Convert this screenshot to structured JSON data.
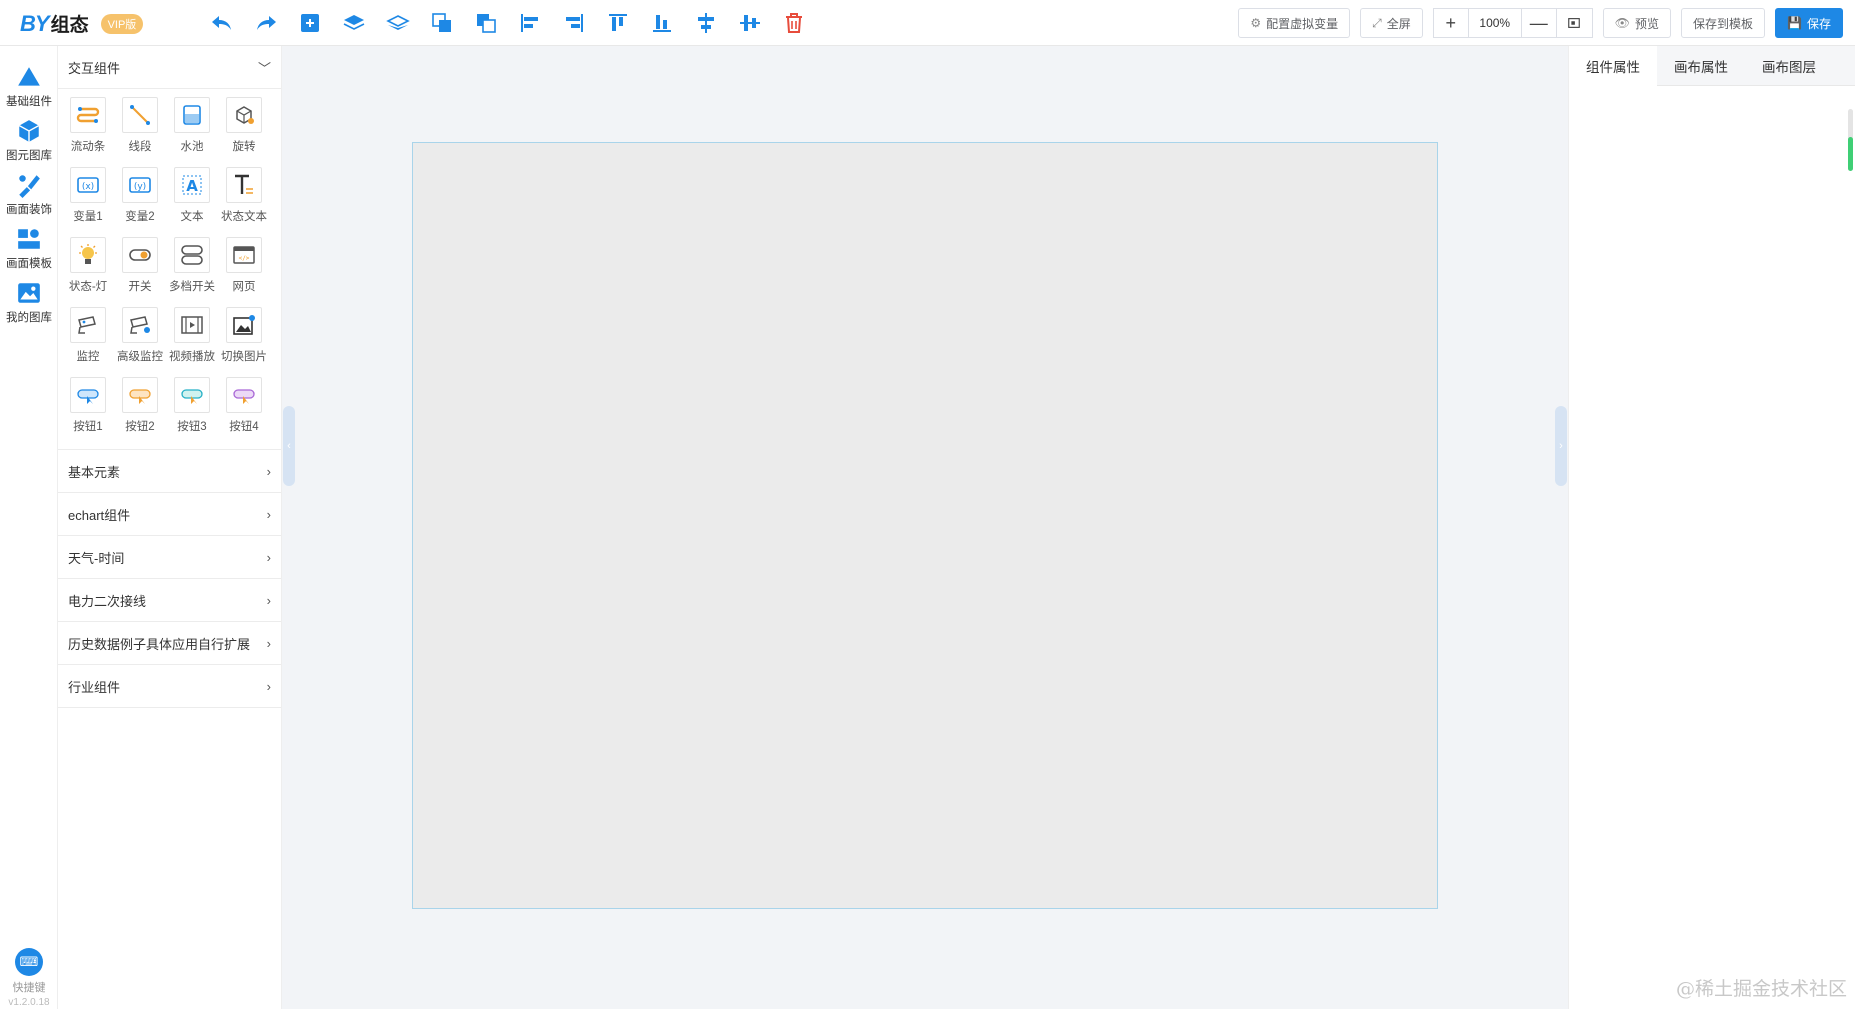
{
  "logo": {
    "brand": "BY",
    "product": "组态",
    "badge": "VIP版"
  },
  "toolbar": {
    "tools": [
      {
        "name": "undo-icon"
      },
      {
        "name": "redo-icon"
      },
      {
        "name": "add-icon"
      },
      {
        "name": "layer-up-icon"
      },
      {
        "name": "layer-down-icon"
      },
      {
        "name": "bring-front-icon"
      },
      {
        "name": "send-back-icon"
      },
      {
        "name": "align-left-icon"
      },
      {
        "name": "align-right-icon"
      },
      {
        "name": "align-top-icon"
      },
      {
        "name": "align-bottom-icon"
      },
      {
        "name": "align-hcenter-icon"
      },
      {
        "name": "align-vcenter-icon"
      },
      {
        "name": "delete-icon"
      }
    ],
    "config_vars": "配置虚拟变量",
    "fullscreen": "全屏",
    "zoom_in": "+",
    "zoom_value": "100%",
    "zoom_out": "—",
    "preview": "预览",
    "save_template": "保存到模板",
    "save": "保存"
  },
  "rail": {
    "items": [
      {
        "label": "基础组件",
        "icon": "triangle-icon"
      },
      {
        "label": "图元图库",
        "icon": "cube-icon"
      },
      {
        "label": "画面装饰",
        "icon": "brush-icon"
      },
      {
        "label": "画面模板",
        "icon": "template-icon"
      },
      {
        "label": "我的图库",
        "icon": "image-icon"
      }
    ],
    "shortcut": "快捷键",
    "version": "v1.2.0.18"
  },
  "panel": {
    "expanded": {
      "title": "交互组件",
      "items": [
        {
          "label": "流动条",
          "icon": "flow-bar-icon"
        },
        {
          "label": "线段",
          "icon": "line-icon"
        },
        {
          "label": "水池",
          "icon": "pool-icon"
        },
        {
          "label": "旋转",
          "icon": "rotate-icon"
        },
        {
          "label": "变量1",
          "icon": "variable1-icon"
        },
        {
          "label": "变量2",
          "icon": "variable2-icon"
        },
        {
          "label": "文本",
          "icon": "text-icon"
        },
        {
          "label": "状态文本",
          "icon": "status-text-icon"
        },
        {
          "label": "状态-灯",
          "icon": "status-light-icon"
        },
        {
          "label": "开关",
          "icon": "switch-icon"
        },
        {
          "label": "多档开关",
          "icon": "multi-switch-icon"
        },
        {
          "label": "网页",
          "icon": "webpage-icon"
        },
        {
          "label": "监控",
          "icon": "camera-icon"
        },
        {
          "label": "高级监控",
          "icon": "advanced-camera-icon"
        },
        {
          "label": "视频播放",
          "icon": "video-icon"
        },
        {
          "label": "切换图片",
          "icon": "switch-image-icon"
        },
        {
          "label": "按钮1",
          "icon": "button1-icon"
        },
        {
          "label": "按钮2",
          "icon": "button2-icon"
        },
        {
          "label": "按钮3",
          "icon": "button3-icon"
        },
        {
          "label": "按钮4",
          "icon": "button4-icon"
        }
      ]
    },
    "sections": [
      {
        "title": "基本元素"
      },
      {
        "title": "echart组件"
      },
      {
        "title": "天气-时间"
      },
      {
        "title": "电力二次接线"
      },
      {
        "title": "历史数据例子具体应用自行扩展"
      },
      {
        "title": "行业组件"
      }
    ]
  },
  "right_panel": {
    "tabs": [
      {
        "label": "组件属性",
        "active": true
      },
      {
        "label": "画布属性",
        "active": false
      },
      {
        "label": "画布图层",
        "active": false
      }
    ]
  },
  "colors": {
    "accent": "#1e88e5",
    "danger": "#e74c3c",
    "orange": "#f0a030"
  },
  "watermark": "@稀土掘金技术社区"
}
